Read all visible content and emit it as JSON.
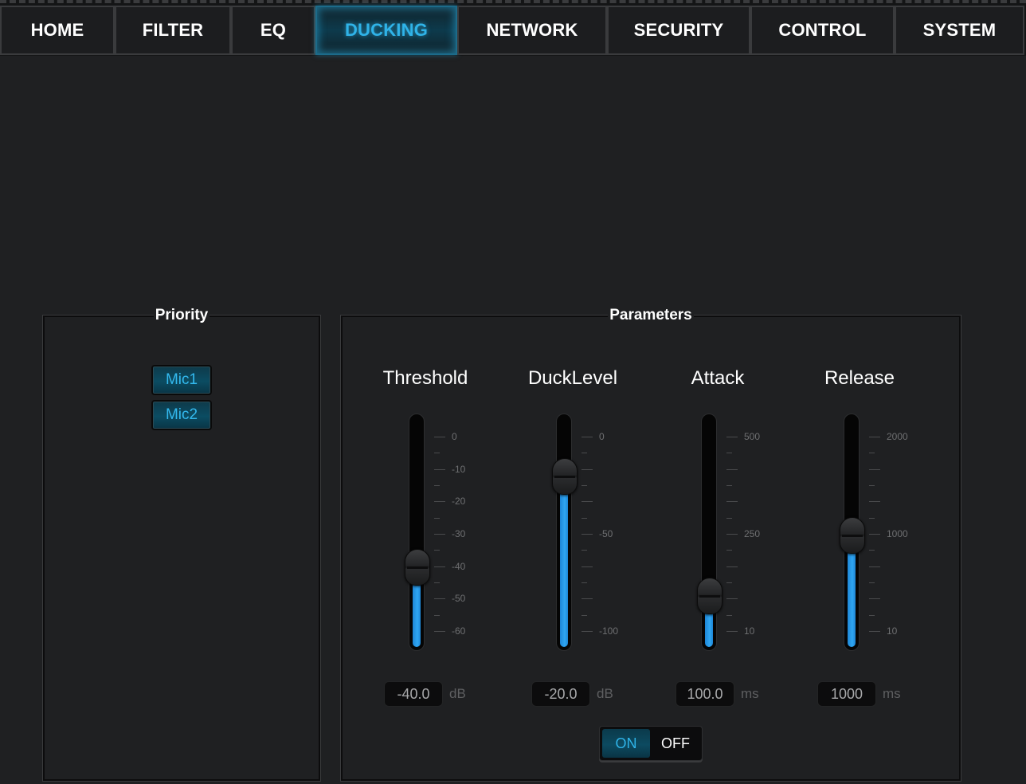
{
  "nav": {
    "tabs": [
      {
        "label": "HOME",
        "active": false
      },
      {
        "label": "FILTER",
        "active": false
      },
      {
        "label": "EQ",
        "active": false
      },
      {
        "label": "DUCKING",
        "active": true
      },
      {
        "label": "NETWORK",
        "active": false
      },
      {
        "label": "SECURITY",
        "active": false
      },
      {
        "label": "CONTROL",
        "active": false
      },
      {
        "label": "SYSTEM",
        "active": false
      }
    ]
  },
  "priority": {
    "title": "Priority",
    "items": [
      "Mic1",
      "Mic2"
    ]
  },
  "parameters": {
    "title": "Parameters",
    "sliders": [
      {
        "label": "Threshold",
        "value": "-40.0",
        "unit": "dB",
        "scale": [
          "0",
          "-10",
          "-20",
          "-30",
          "-40",
          "-50",
          "-60"
        ],
        "min": -60,
        "max": 0,
        "current": -40
      },
      {
        "label": "DuckLevel",
        "value": "-20.0",
        "unit": "dB",
        "scale": [
          "0",
          "-50",
          "-100"
        ],
        "min": -100,
        "max": 0,
        "current": -20
      },
      {
        "label": "Attack",
        "value": "100.0",
        "unit": "ms",
        "scale": [
          "500",
          "250",
          "10"
        ],
        "min": 10,
        "max": 500,
        "current": 100
      },
      {
        "label": "Release",
        "value": "1000",
        "unit": "ms",
        "scale": [
          "2000",
          "1000",
          "10"
        ],
        "min": 10,
        "max": 2000,
        "current": 1000
      }
    ],
    "toggle": {
      "on_label": "ON",
      "off_label": "OFF",
      "state": "ON"
    }
  },
  "colors": {
    "accent": "#2fb3e8",
    "fill": "#2fa6f2",
    "background": "#1f2022"
  }
}
